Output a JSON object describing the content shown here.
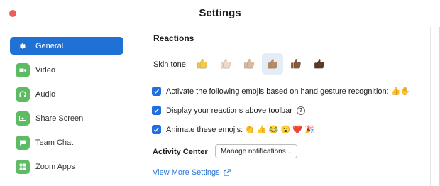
{
  "window": {
    "title": "Settings"
  },
  "sidebar": {
    "items": [
      {
        "label": "General",
        "icon": "gear-icon",
        "active": true
      },
      {
        "label": "Video",
        "icon": "video-icon",
        "active": false
      },
      {
        "label": "Audio",
        "icon": "headphones-icon",
        "active": false
      },
      {
        "label": "Share Screen",
        "icon": "share-screen-icon",
        "active": false
      },
      {
        "label": "Team Chat",
        "icon": "chat-icon",
        "active": false
      },
      {
        "label": "Zoom Apps",
        "icon": "apps-icon",
        "active": false
      }
    ]
  },
  "reactions": {
    "title": "Reactions",
    "skin_tone_label": "Skin tone:",
    "skin_tones": [
      "#f2c94c",
      "#f1d8c4",
      "#e0b896",
      "#b98a66",
      "#8a5a3c",
      "#5b3a26"
    ],
    "selected_tone_index": 3,
    "options": [
      {
        "label": "Activate the following emojis based on hand gesture recognition:",
        "emojis": "👍✋",
        "checked": true
      },
      {
        "label": "Display your reactions above toolbar",
        "emojis": "",
        "checked": true,
        "help": "?"
      },
      {
        "label": "Animate these emojis:",
        "emojis": "👏 👍 😂 😮 ❤️ 🎉",
        "checked": true
      }
    ]
  },
  "activity_center": {
    "label": "Activity Center",
    "button_label": "Manage notifications..."
  },
  "view_more": {
    "label": "View More Settings"
  },
  "colors": {
    "accent": "#2071d6",
    "link": "#2d74d6",
    "close": "#ee5e57"
  }
}
